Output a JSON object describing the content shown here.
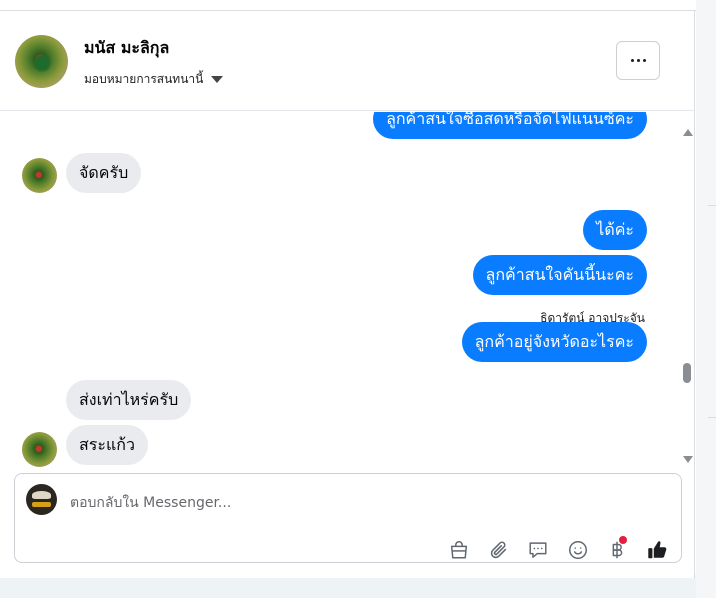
{
  "contact": {
    "name": "มนัส มะลิกุล",
    "assign_label": "มอบหมายการสนทนานี้"
  },
  "messages": [
    {
      "direction": "out",
      "text": "ลูกค้าสนใจซื้อสดหรือจัดไฟแนนซ์คะ"
    },
    {
      "direction": "in",
      "text": "จัดครับ"
    },
    {
      "direction": "out",
      "text": "ได้ค่ะ"
    },
    {
      "direction": "out",
      "text": "ลูกค้าสนใจคันนี้นะคะ"
    },
    {
      "direction": "out",
      "text": "ลูกค้าอยู่จังหวัดอะไรคะ",
      "sender": "ธิดารัตน์ อาจประจัน"
    },
    {
      "direction": "in",
      "text": "ส่งเท่าไหร่ครับ"
    },
    {
      "direction": "in",
      "text": "สระแก้ว"
    }
  ],
  "composer": {
    "placeholder": "ตอบกลับใน Messenger..."
  },
  "toolbar": {
    "icons": [
      "shopping-bag-icon",
      "paperclip-icon",
      "saved-reply-icon",
      "emoji-icon",
      "baht-payment-icon",
      "thumbs-up-icon"
    ]
  },
  "colors": {
    "outgoing_bubble": "#0a7cff",
    "incoming_bubble": "#e9ebee",
    "notification_dot": "#e41e3f"
  }
}
